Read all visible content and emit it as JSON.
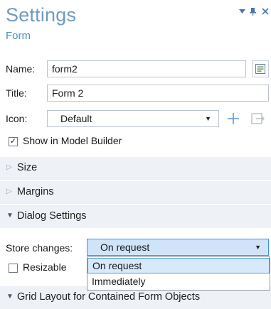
{
  "header": {
    "title": "Settings",
    "subtitle": "Form",
    "controls": {
      "menu": "▼",
      "pin": "⊥",
      "close": "✕"
    }
  },
  "form": {
    "name_label": "Name:",
    "name_value": "form2",
    "title_label": "Title:",
    "title_value": "Form 2",
    "icon_label": "Icon:",
    "icon_value": "Default",
    "show_in_builder_label": "Show in Model Builder",
    "show_in_builder_checked": true
  },
  "sections": [
    {
      "label": "Size",
      "expanded": false
    },
    {
      "label": "Margins",
      "expanded": false
    },
    {
      "label": "Dialog Settings",
      "expanded": true
    },
    {
      "label": "Grid Layout for Contained Form Objects",
      "expanded": true
    }
  ],
  "dialog": {
    "store_changes_label": "Store changes:",
    "store_changes_value": "On request",
    "resizable_label": "Resizable",
    "resizable_checked": false,
    "options": [
      "On request",
      "Immediately"
    ],
    "selected_option": "On request"
  },
  "colors": {
    "title": "#6f9bc0",
    "accent": "#4d8fc9",
    "section_bg": "#eef1f5",
    "dropdown_highlight": "#d7e9fb"
  }
}
